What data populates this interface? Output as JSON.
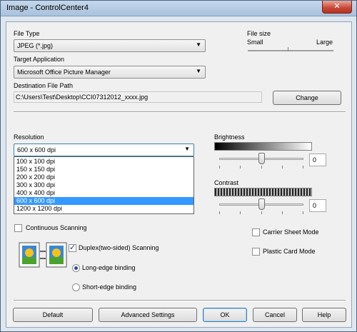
{
  "window": {
    "title": "Image - ControlCenter4",
    "close_glyph": "✕"
  },
  "file_type": {
    "label": "File Type",
    "selected": "JPEG (*.jpg)"
  },
  "file_size": {
    "label": "File size",
    "small": "Small",
    "large": "Large",
    "level": 0.6
  },
  "target_application": {
    "label": "Target Application",
    "selected": "Microsoft Office Picture Manager"
  },
  "destination": {
    "label": "Destination File Path",
    "value": "C:\\Users\\Test\\Desktop\\CCI07312012_xxxx.jpg",
    "change_button": "Change"
  },
  "resolution": {
    "label": "Resolution",
    "selected": "600 x 600 dpi",
    "options": [
      "100 x 100 dpi",
      "150 x 150 dpi",
      "200 x 200 dpi",
      "300 x 300 dpi",
      "400 x 400 dpi",
      "600 x 600 dpi",
      "1200 x 1200 dpi"
    ],
    "selected_index": 5
  },
  "brightness": {
    "label": "Brightness",
    "value": "0",
    "level": 0.5
  },
  "contrast": {
    "label": "Contrast",
    "value": "0",
    "level": 0.5
  },
  "options": {
    "continuous_scanning": {
      "label": "Continuous Scanning",
      "checked": false
    },
    "duplex": {
      "label": "Duplex(two-sided) Scanning",
      "checked": true
    },
    "long_edge": {
      "label": "Long-edge binding",
      "selected": true
    },
    "short_edge": {
      "label": "Short-edge binding",
      "selected": false
    },
    "carrier_sheet": {
      "label": "Carrier Sheet Mode",
      "checked": false
    },
    "plastic_card": {
      "label": "Plastic Card Mode",
      "checked": false
    }
  },
  "buttons": {
    "default": "Default",
    "advanced": "Advanced Settings",
    "ok": "OK",
    "cancel": "Cancel",
    "help": "Help"
  },
  "colors": {
    "selection": "#3399ff",
    "title_gradient_top": "#c5d7ea",
    "close_red": "#c74535"
  }
}
